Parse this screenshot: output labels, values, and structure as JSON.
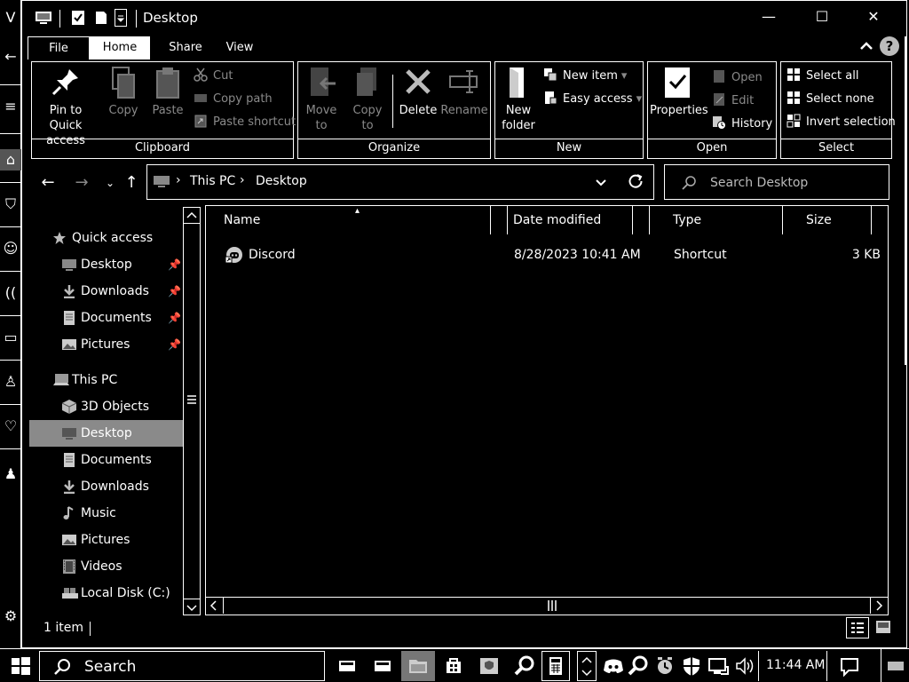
{
  "window": {
    "title": "Desktop",
    "controls": {
      "minimize": "—",
      "maximize": "☐",
      "close": "✕"
    }
  },
  "ribbon": {
    "tabs": [
      "File",
      "Home",
      "Share",
      "View"
    ],
    "active_tab": "Home",
    "groups": {
      "clipboard": {
        "label": "Clipboard",
        "pin": "Pin to Quick access",
        "pin_line1": "Pin to Quick",
        "pin_line2": "access",
        "copy": "Copy",
        "paste": "Paste",
        "cut": "Cut",
        "copy_path": "Copy path",
        "paste_shortcut": "Paste shortcut"
      },
      "organize": {
        "label": "Organize",
        "move_to_1": "Move",
        "move_to_2": "to",
        "copy_to_1": "Copy",
        "copy_to_2": "to",
        "delete": "Delete",
        "rename": "Rename"
      },
      "new": {
        "label": "New",
        "new_folder_1": "New",
        "new_folder_2": "folder",
        "new_item": "New item",
        "easy_access": "Easy access"
      },
      "open": {
        "label": "Open",
        "properties": "Properties",
        "open": "Open",
        "edit": "Edit",
        "history": "History"
      },
      "select": {
        "label": "Select",
        "select_all": "Select all",
        "select_none": "Select none",
        "invert_selection": "Invert selection"
      }
    }
  },
  "address": {
    "crumbs": [
      "This PC",
      "Desktop"
    ],
    "search_placeholder": "Search Desktop"
  },
  "nav_pane": {
    "quick_access": "Quick access",
    "quick_items": [
      "Desktop",
      "Downloads",
      "Documents",
      "Pictures"
    ],
    "this_pc": "This PC",
    "pc_items": [
      "3D Objects",
      "Desktop",
      "Documents",
      "Downloads",
      "Music",
      "Pictures",
      "Videos",
      "Local Disk (C:)"
    ],
    "selected": "Desktop"
  },
  "file_list": {
    "columns": [
      "Name",
      "Date modified",
      "Type",
      "Size"
    ],
    "rows": [
      {
        "name": "Discord",
        "date": "8/28/2023 10:41 AM",
        "type": "Shortcut",
        "size": "3 KB"
      }
    ]
  },
  "status": {
    "item_count": "1 item"
  },
  "taskbar": {
    "search_label": "Search",
    "time": "11:44 AM"
  },
  "colors": {
    "background": "#000000",
    "foreground": "#ffffff",
    "selection": "#8a8a8a"
  }
}
